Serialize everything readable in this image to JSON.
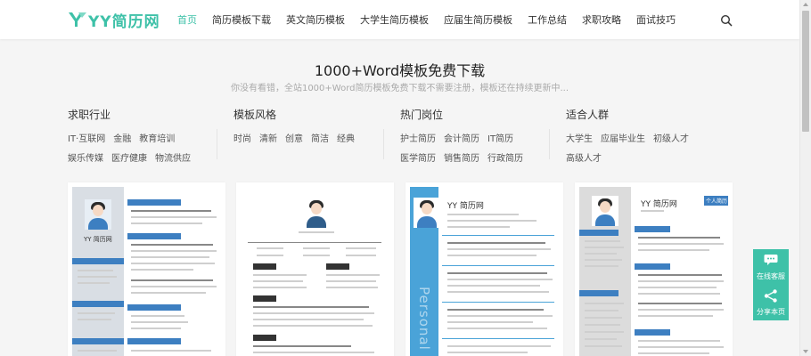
{
  "brand": {
    "name": "YY简历网",
    "color": "#3ec1a8"
  },
  "nav": {
    "items": [
      {
        "label": "首页",
        "active": true
      },
      {
        "label": "简历模板下载"
      },
      {
        "label": "英文简历模板"
      },
      {
        "label": "大学生简历模板"
      },
      {
        "label": "应届生简历模板"
      },
      {
        "label": "工作总结"
      },
      {
        "label": "求职攻略"
      },
      {
        "label": "面试技巧"
      }
    ],
    "search_icon": "search-icon"
  },
  "hero": {
    "title": "1000+Word模板免费下载",
    "subtitle": "你没有看错，全站1000+Word简历模板免费下载不需要注册，模板还在持续更新中..."
  },
  "filters": [
    {
      "title": "求职行业",
      "tags": [
        "IT·互联网",
        "金融",
        "教育培训",
        "娱乐传媒",
        "医疗健康",
        "物流供应"
      ]
    },
    {
      "title": "模板风格",
      "tags": [
        "时尚",
        "清新",
        "创意",
        "简洁",
        "经典"
      ]
    },
    {
      "title": "热门岗位",
      "tags": [
        "护士简历",
        "会计简历",
        "IT简历",
        "医学简历",
        "销售简历",
        "行政简历"
      ]
    },
    {
      "title": "适合人群",
      "tags": [
        "大学生",
        "应届毕业生",
        "初级人才",
        "高级人才"
      ]
    }
  ],
  "templates": [
    {
      "name": "YY 简历网",
      "accent": "#3d7fc1"
    },
    {
      "name": "",
      "accent": "#333333"
    },
    {
      "name": "YY 简历网",
      "accent": "#4aa3d8",
      "side_text": "Personal"
    },
    {
      "name": "YY 简历网",
      "accent": "#3d7fc1",
      "badge": "个人简历"
    }
  ],
  "float_buttons": [
    {
      "label": "在线客服",
      "icon": "chat-icon"
    },
    {
      "label": "分享本页",
      "icon": "share-icon"
    }
  ]
}
